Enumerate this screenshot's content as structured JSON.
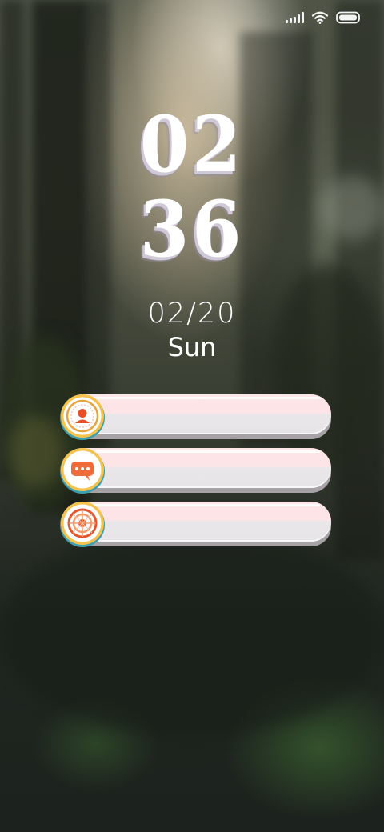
{
  "clock": {
    "hour": "02",
    "minute": "36"
  },
  "date": {
    "date_text": "02/20",
    "weekday": "Sun"
  },
  "shortcuts": [
    {
      "icon": "contacts-icon",
      "icon_color": "#e84d25"
    },
    {
      "icon": "message-icon",
      "icon_color": "#f06a3a"
    },
    {
      "icon": "browser-icon",
      "icon_color": "#e9542c"
    }
  ]
}
